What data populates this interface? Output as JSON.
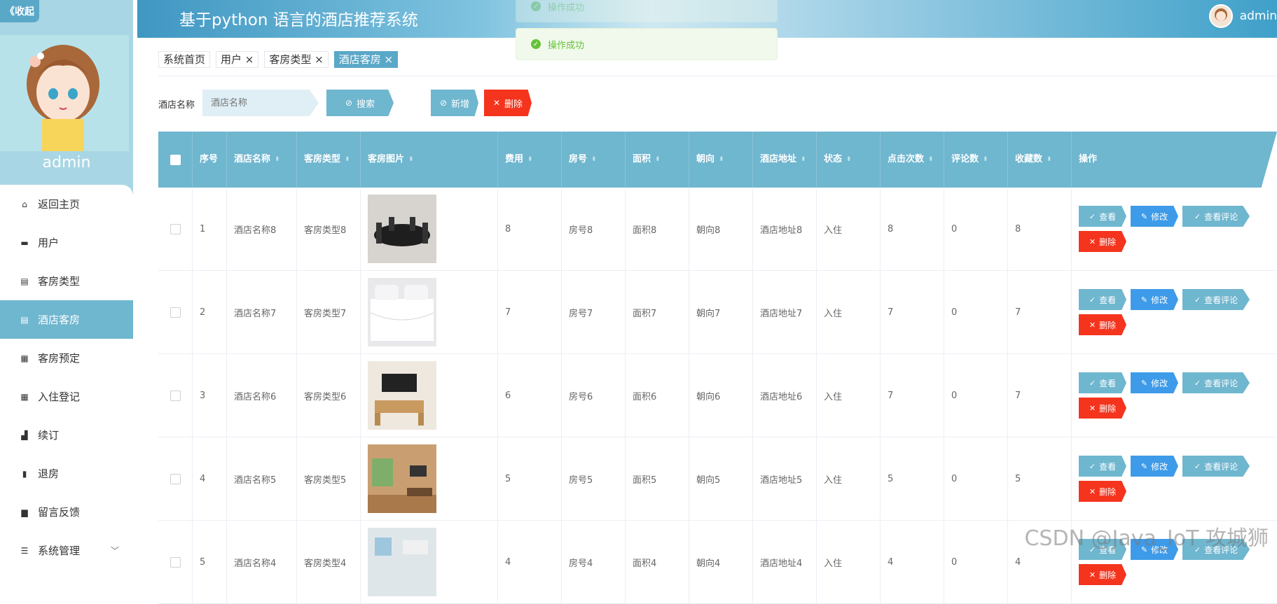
{
  "sidebar": {
    "collapse_label": "《收起",
    "username": "admin",
    "items": [
      {
        "label": "返回主页",
        "icon": "home-icon"
      },
      {
        "label": "用户",
        "icon": "monitor-icon"
      },
      {
        "label": "客房类型",
        "icon": "clipboard-icon"
      },
      {
        "label": "酒店客房",
        "icon": "clipboard-icon"
      },
      {
        "label": "客房预定",
        "icon": "grid-icon"
      },
      {
        "label": "入住登记",
        "icon": "grid-icon"
      },
      {
        "label": "续订",
        "icon": "stamp-icon"
      },
      {
        "label": "退房",
        "icon": "door-icon"
      },
      {
        "label": "留言反馈",
        "icon": "printer-icon"
      },
      {
        "label": "系统管理",
        "icon": "sliders-icon"
      }
    ],
    "active_index": 3
  },
  "header": {
    "title": "基于python 语言的酒店推荐系统",
    "user": "admin"
  },
  "toasts": [
    {
      "text": "操作成功"
    },
    {
      "text": "操作成功"
    }
  ],
  "tabs": [
    {
      "label": "系统首页"
    },
    {
      "label": "用户 ×"
    },
    {
      "label": "客房类型 ×"
    },
    {
      "label": "酒店客房 ×"
    }
  ],
  "search": {
    "label": "酒店名称",
    "placeholder": "酒店名称",
    "search_btn": "搜索",
    "add_btn": "新增",
    "delete_btn": "删除"
  },
  "table": {
    "columns": [
      "序号",
      "酒店名称",
      "客房类型",
      "客房图片",
      "费用",
      "房号",
      "面积",
      "朝向",
      "酒店地址",
      "状态",
      "点击次数",
      "评论数",
      "收藏数",
      "操作"
    ],
    "rows": [
      {
        "no": "1",
        "hotel": "酒店名称8",
        "type": "客房类型8",
        "fee": "8",
        "room": "房号8",
        "area": "面积8",
        "orient": "朝向8",
        "addr": "酒店地址8",
        "status": "入住",
        "clicks": "8",
        "comments": "0",
        "favs": "8"
      },
      {
        "no": "2",
        "hotel": "酒店名称7",
        "type": "客房类型7",
        "fee": "7",
        "room": "房号7",
        "area": "面积7",
        "orient": "朝向7",
        "addr": "酒店地址7",
        "status": "入住",
        "clicks": "7",
        "comments": "0",
        "favs": "7"
      },
      {
        "no": "3",
        "hotel": "酒店名称6",
        "type": "客房类型6",
        "fee": "6",
        "room": "房号6",
        "area": "面积6",
        "orient": "朝向6",
        "addr": "酒店地址6",
        "status": "入住",
        "clicks": "7",
        "comments": "0",
        "favs": "7"
      },
      {
        "no": "4",
        "hotel": "酒店名称5",
        "type": "客房类型5",
        "fee": "5",
        "room": "房号5",
        "area": "面积5",
        "orient": "朝向5",
        "addr": "酒店地址5",
        "status": "入住",
        "clicks": "5",
        "comments": "0",
        "favs": "5"
      },
      {
        "no": "5",
        "hotel": "酒店名称4",
        "type": "客房类型4",
        "fee": "4",
        "room": "房号4",
        "area": "面积4",
        "orient": "朝向4",
        "addr": "酒店地址4",
        "status": "入住",
        "clicks": "4",
        "comments": "0",
        "favs": "4"
      }
    ],
    "ops": {
      "view": "查看",
      "edit": "修改",
      "review": "查看评论",
      "delete": "删除"
    }
  },
  "watermark": "CSDN @Java_IoT 攻城狮",
  "colors": {
    "accent": "#6fb6cf",
    "danger": "#f5341d",
    "edit": "#3d9be9",
    "success": "#67c23a"
  }
}
